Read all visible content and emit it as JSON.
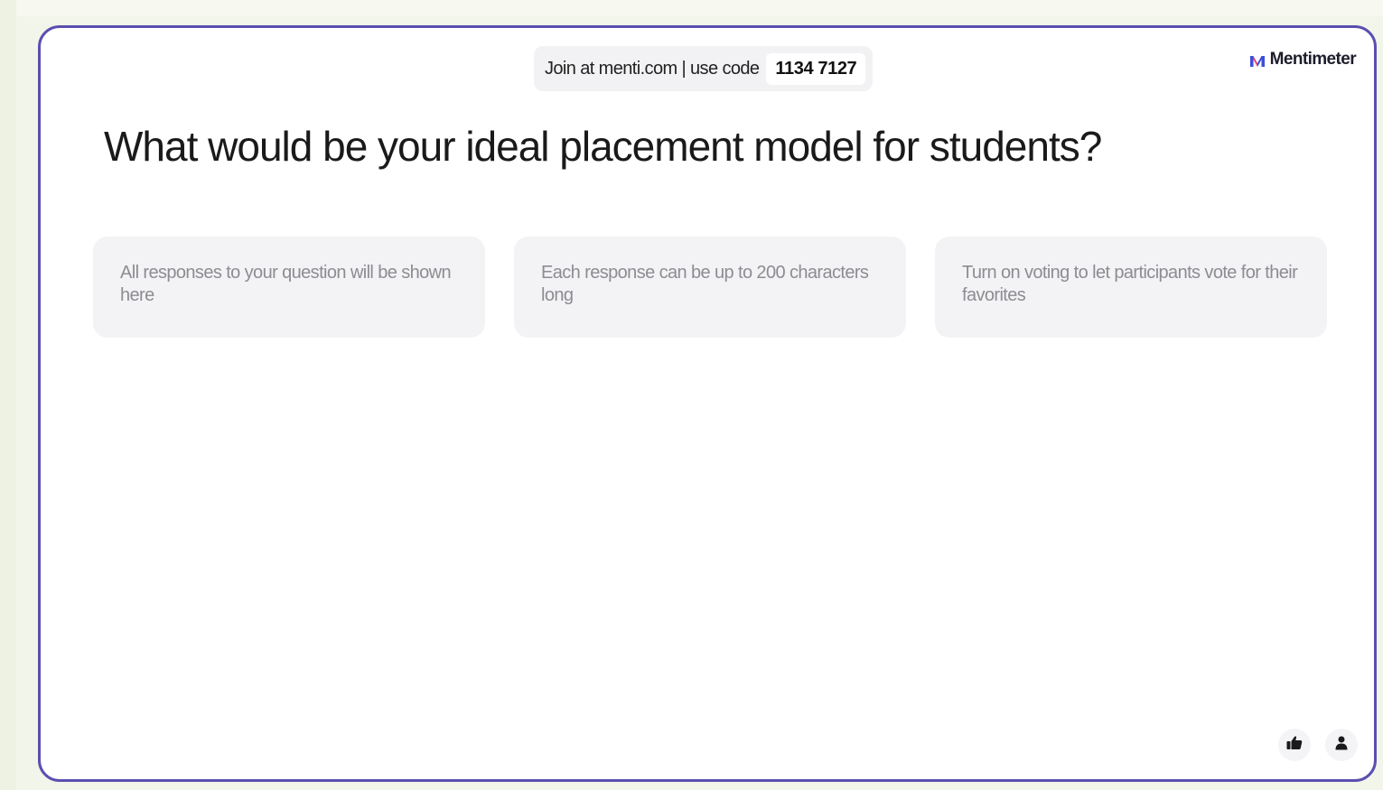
{
  "join": {
    "text": "Join at menti.com | use code",
    "code": "1134 7127"
  },
  "brand": {
    "name": "Mentimeter",
    "logo_icon": "mentimeter-logo-icon",
    "colors": {
      "accent": "#5a4fb0",
      "logo_blue": "#3b4fd8",
      "logo_pink": "#e0437c"
    }
  },
  "question": {
    "title": "What would be your ideal placement model for students?"
  },
  "placeholders": [
    {
      "text": "All responses to your question will be shown here"
    },
    {
      "text": "Each response can be up to 200 characters long"
    },
    {
      "text": "Turn on voting to let participants vote for their favorites"
    }
  ],
  "controls": {
    "reactions_icon": "thumbs-up-icon",
    "participants_icon": "person-icon"
  }
}
